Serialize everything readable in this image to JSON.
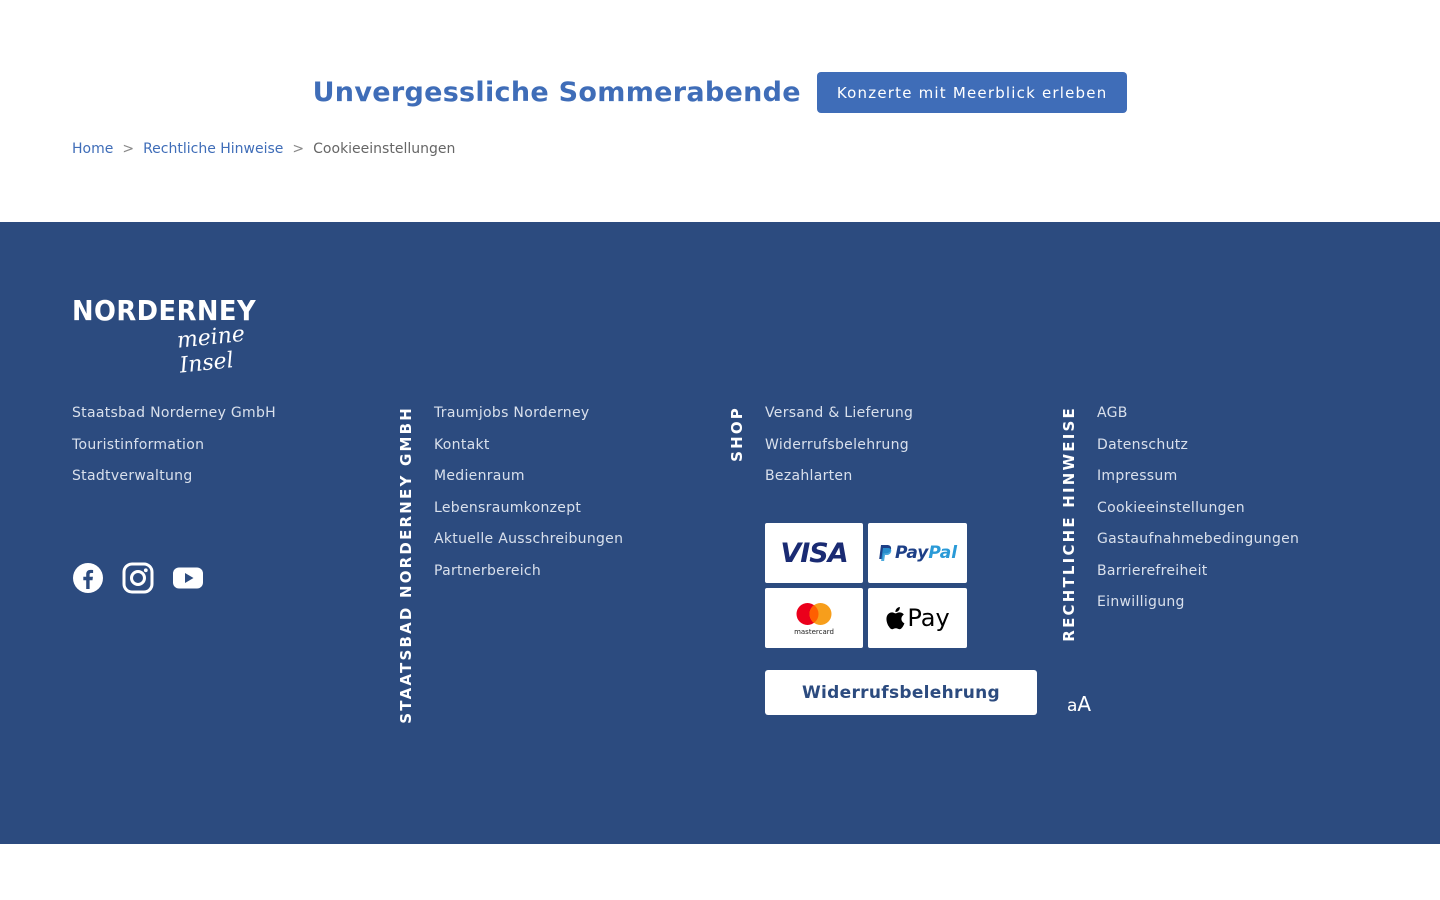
{
  "promo": {
    "title": "Unvergessliche Sommerabende",
    "button_label": "Konzerte mit Meerblick erleben"
  },
  "breadcrumb": {
    "items": [
      "Home",
      "Rechtliche Hinweise"
    ],
    "separator": ">",
    "current": "Cookieeinstellungen"
  },
  "footer": {
    "logo": {
      "main": "NORDERNEY",
      "sub": "meine Insel"
    },
    "column_1": [
      "Staatsbad Norderney GmbH",
      "Touristinformation",
      "Stadtverwaltung"
    ],
    "column_2": {
      "heading": "STAATSBAD NORDERNEY GMBH",
      "links": [
        "Traumjobs Norderney",
        "Kontakt",
        "Medienraum",
        "Lebensraumkonzept",
        "Aktuelle Ausschreibungen",
        "Partnerbereich"
      ]
    },
    "column_3": {
      "heading": "SHOP",
      "links": [
        "Versand & Lieferung",
        "Widerrufsbelehrung",
        "Bezahlarten"
      ]
    },
    "column_4": {
      "heading": "RECHTLICHE HINWEISE",
      "links": [
        "AGB",
        "Datenschutz",
        "Impressum",
        "Cookieeinstellungen",
        "Gastaufnahmebedingungen",
        "Barrierefreiheit",
        "Einwilligung"
      ]
    },
    "social_icons": [
      "facebook-icon",
      "instagram-icon",
      "youtube-icon"
    ],
    "payments": {
      "visa": "VISA",
      "paypal_1": "Pay",
      "paypal_2": "Pal",
      "mastercard": "mastercard",
      "applepay": "Pay"
    },
    "widerruf_button": "Widerrufsbelehrung",
    "font_size_toggle": {
      "small": "a",
      "large": "A"
    }
  },
  "colors": {
    "accent": "#3f6db8",
    "footer_bg": "#2c4b7f",
    "text_light": "#d9e0ec"
  }
}
